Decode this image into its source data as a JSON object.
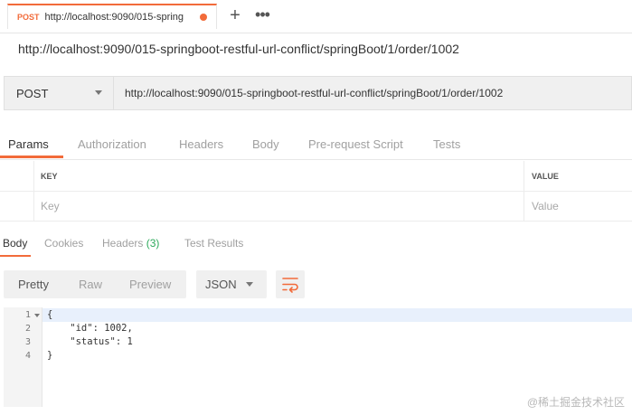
{
  "tab": {
    "method": "POST",
    "url_truncated": "http://localhost:9090/015-spring",
    "new_tab": "+",
    "more": "•••"
  },
  "request_name": "http://localhost:9090/015-springboot-restful-url-conflict/springBoot/1/order/1002",
  "request": {
    "method": "POST",
    "url": "http://localhost:9090/015-springboot-restful-url-conflict/springBoot/1/order/1002"
  },
  "request_tabs": [
    "Params",
    "Authorization",
    "Headers",
    "Body",
    "Pre-request Script",
    "Tests"
  ],
  "params_table": {
    "headers": [
      "KEY",
      "VALUE"
    ],
    "placeholders": {
      "key": "Key",
      "value": "Value"
    }
  },
  "response_tabs": {
    "body": "Body",
    "cookies": "Cookies",
    "headers": "Headers",
    "headers_count": "(3)",
    "test_results": "Test Results"
  },
  "view_modes": [
    "Pretty",
    "Raw",
    "Preview"
  ],
  "format": "JSON",
  "code": {
    "line_numbers": [
      "1",
      "2",
      "3",
      "4"
    ],
    "lines": [
      "{",
      "    \"id\": 1002,",
      "    \"status\": 1",
      "}"
    ]
  },
  "watermark": "@稀土掘金技术社区",
  "colors": {
    "accent": "#f26b3a",
    "count": "#2eaa5c"
  }
}
